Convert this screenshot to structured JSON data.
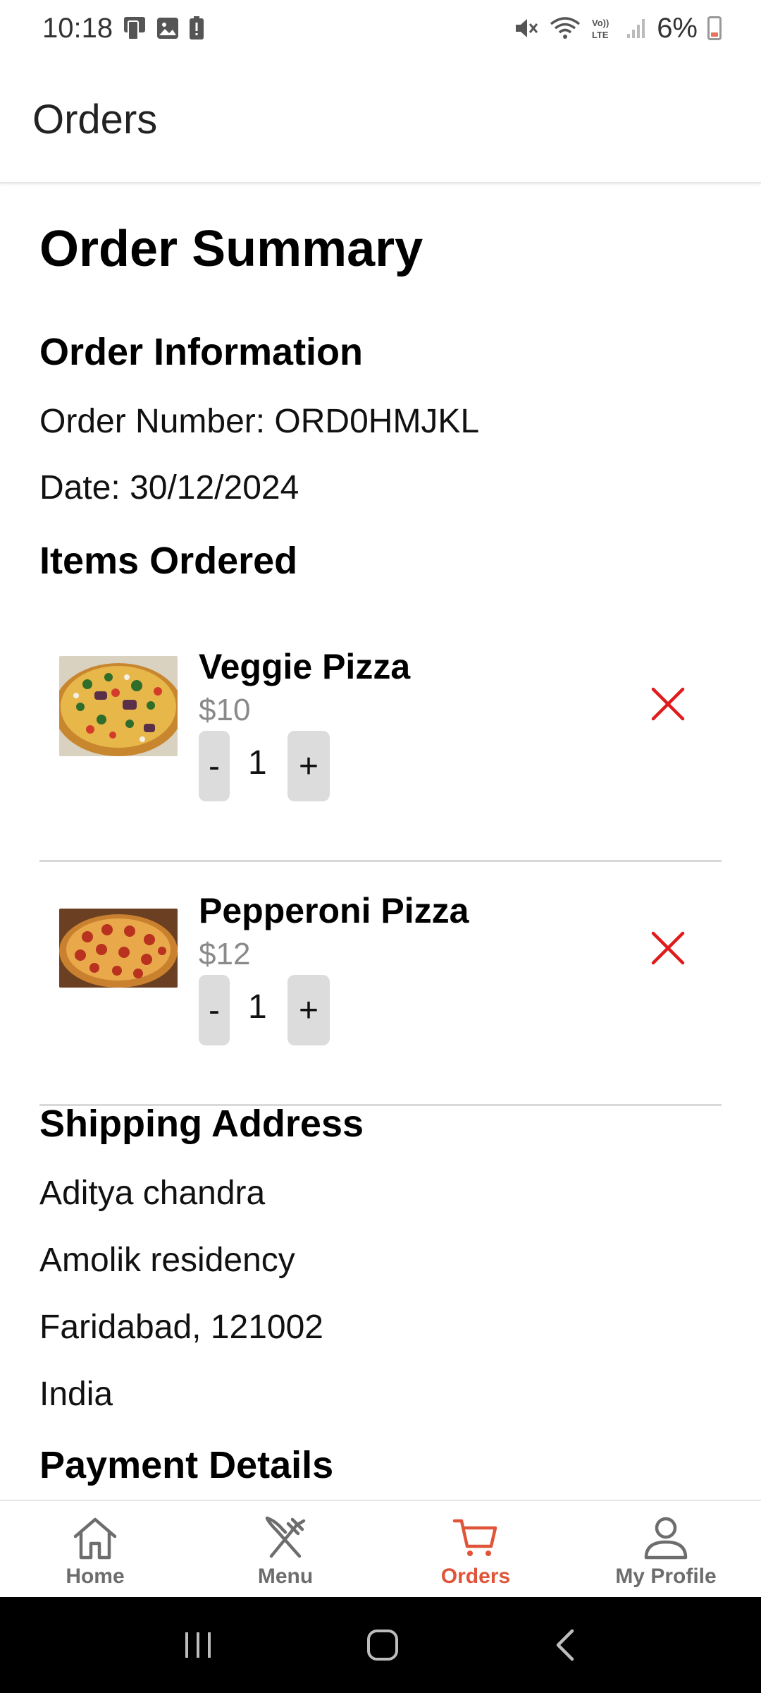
{
  "status_bar": {
    "time": "10:18",
    "battery_percent": "6%",
    "icons": [
      "tablet-icon",
      "image-icon",
      "battery-alert-icon",
      "mute-icon",
      "wifi-icon",
      "volte-icon",
      "signal-icon",
      "battery-icon"
    ]
  },
  "app_bar": {
    "title": "Orders"
  },
  "summary": {
    "title": "Order Summary",
    "order_info_heading": "Order Information",
    "order_number": "Order Number: ORD0HMJKL",
    "date": "Date: 30/12/2024",
    "items_heading": "Items Ordered",
    "items": [
      {
        "name": "Veggie Pizza",
        "price": "$10",
        "quantity": "1",
        "minus_label": "-",
        "plus_label": "+"
      },
      {
        "name": "Pepperoni Pizza",
        "price": "$12",
        "quantity": "1",
        "minus_label": "-",
        "plus_label": "+"
      }
    ],
    "shipping_heading": "Shipping Address",
    "shipping": {
      "name": "Aditya chandra",
      "line1": "Amolik residency",
      "city": "Faridabad, 121002",
      "country": "India"
    },
    "payment_heading": "Payment Details"
  },
  "bottom_nav": {
    "items": [
      {
        "label": "Home",
        "icon": "home-icon",
        "active": false
      },
      {
        "label": "Menu",
        "icon": "utensils-icon",
        "active": false
      },
      {
        "label": "Orders",
        "icon": "cart-icon",
        "active": true
      },
      {
        "label": "My Profile",
        "icon": "user-icon",
        "active": false
      }
    ]
  },
  "colors": {
    "accent": "#e0553a",
    "remove": "#e01b1b",
    "muted": "#8a8a8a"
  }
}
